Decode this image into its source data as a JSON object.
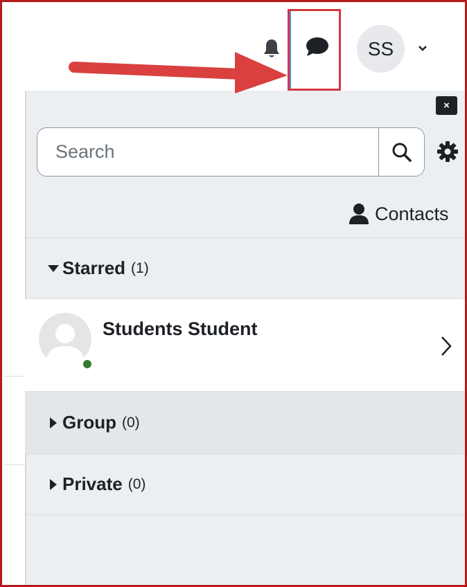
{
  "navbar": {
    "notifications_icon": "bell-icon",
    "messages_icon": "chat-bubble-icon",
    "user_initials": "SS",
    "user_menu_icon": "chevron-down-icon"
  },
  "annotation": {
    "arrow_color": "#d9403f",
    "highlight_color": "#d4383b"
  },
  "drawer": {
    "close_label": "×",
    "search": {
      "placeholder": "Search",
      "value": "",
      "button_icon": "search-icon"
    },
    "settings_icon": "gear-icon",
    "contacts": {
      "icon": "person-icon",
      "label": "Contacts"
    },
    "sections": [
      {
        "title": "Starred",
        "count": "(1)",
        "expanded": true
      },
      {
        "title": "Group",
        "count": "(0)",
        "expanded": false
      },
      {
        "title": "Private",
        "count": "(0)",
        "expanded": false
      }
    ],
    "starred_conversations": [
      {
        "name": "Students Student",
        "status": "online",
        "status_color": "#357a32"
      }
    ]
  },
  "colors": {
    "drawer_bg": "#eceff2",
    "text": "#1d2125",
    "frame_border": "#b31b1b"
  }
}
